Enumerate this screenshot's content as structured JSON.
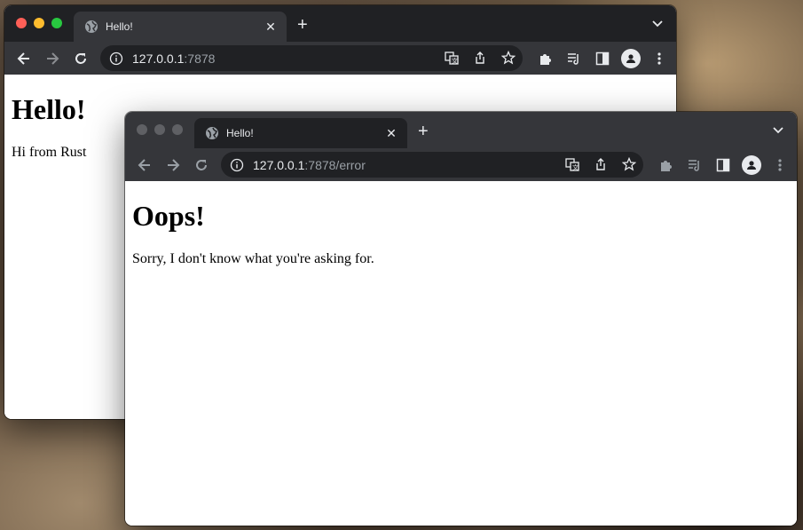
{
  "back_window": {
    "tab": {
      "title": "Hello!",
      "favicon": "globe-icon"
    },
    "address": {
      "host": "127.0.0.1",
      "path": ":7878"
    },
    "page": {
      "heading": "Hello!",
      "paragraph": "Hi from Rust"
    }
  },
  "front_window": {
    "tab": {
      "title": "Hello!",
      "favicon": "globe-icon"
    },
    "address": {
      "host": "127.0.0.1",
      "path": ":7878/error"
    },
    "page": {
      "heading": "Oops!",
      "paragraph": "Sorry, I don't know what you're asking for."
    }
  },
  "colors": {
    "tab_strip_active": "#202124",
    "toolbar": "#35363a",
    "traffic_red": "#ff5f57",
    "traffic_yellow": "#febc2e",
    "traffic_green": "#28c840"
  }
}
